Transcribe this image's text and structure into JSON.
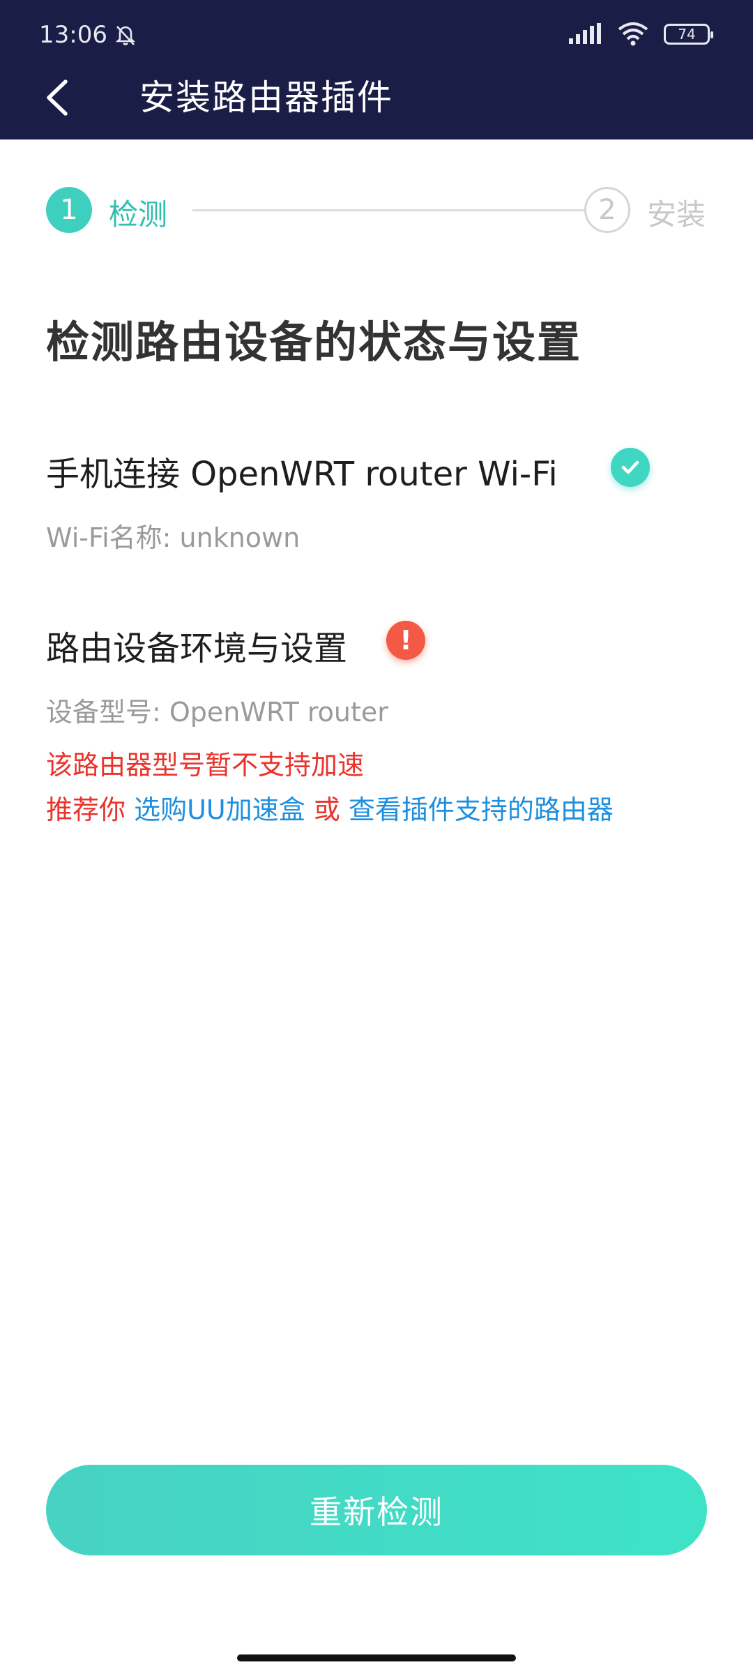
{
  "status_bar": {
    "time": "13:06",
    "battery": "74"
  },
  "header": {
    "title": "安装路由器插件"
  },
  "steps": [
    {
      "number": "1",
      "label": "检测"
    },
    {
      "number": "2",
      "label": "安装"
    }
  ],
  "main": {
    "title": "检测路由设备的状态与设置",
    "wifi_item": {
      "title": "手机连接 OpenWRT router Wi-Fi",
      "sub": "Wi-Fi名称: unknown"
    },
    "router_item": {
      "title": "路由设备环境与设置",
      "sub": "设备型号: OpenWRT router",
      "warning": "该路由器型号暂不支持加速",
      "recommend_prefix": "推荐你 ",
      "link_buy": "选购UU加速盒",
      "or_text": " 或 ",
      "link_supported": "查看插件支持的路由器"
    }
  },
  "footer": {
    "retry_label": "重新检测"
  },
  "colors": {
    "header_bg": "#1a1e47",
    "accent": "#3fcfbf",
    "warning": "#e8342c",
    "link": "#1e8fe0",
    "error_icon": "#f25a45"
  }
}
